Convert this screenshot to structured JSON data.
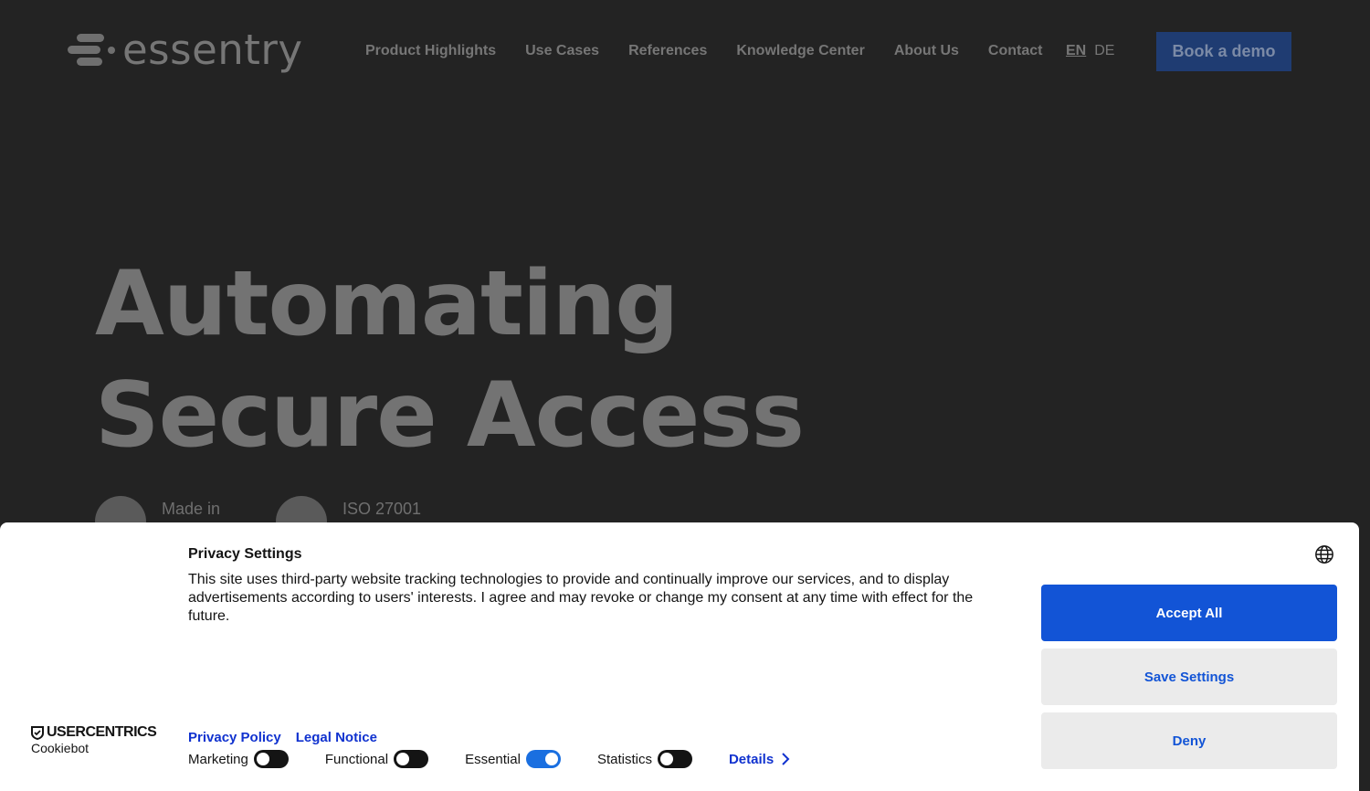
{
  "site": {
    "logo_text": "essentry",
    "nav": [
      "Product Highlights",
      "Use Cases",
      "References",
      "Knowledge Center",
      "About Us",
      "Contact"
    ],
    "lang": {
      "active": "EN",
      "other": "DE"
    },
    "cta": "Book a demo",
    "hero": {
      "line1": "Automating",
      "line2": "Secure Access"
    },
    "badges": [
      {
        "label": "Made in"
      },
      {
        "label": "ISO 27001"
      }
    ]
  },
  "cookie": {
    "title": "Privacy Settings",
    "description": "This site uses third-party website tracking technologies to provide and continually improve our services, and to display advertisements according to users' interests. I agree and may revoke or change my consent at any time with effect for the future.",
    "brand": {
      "name": "USERCENTRICS",
      "sub": "Cookiebot"
    },
    "links": {
      "privacy": "Privacy Policy",
      "legal": "Legal Notice"
    },
    "toggles": [
      {
        "label": "Marketing",
        "on": false
      },
      {
        "label": "Functional",
        "on": false
      },
      {
        "label": "Essential",
        "on": true
      },
      {
        "label": "Statistics",
        "on": false
      }
    ],
    "details": "Details",
    "buttons": {
      "accept": "Accept All",
      "save": "Save Settings",
      "deny": "Deny"
    },
    "colors": {
      "primary": "#1254d6",
      "link": "#1032cf"
    }
  }
}
